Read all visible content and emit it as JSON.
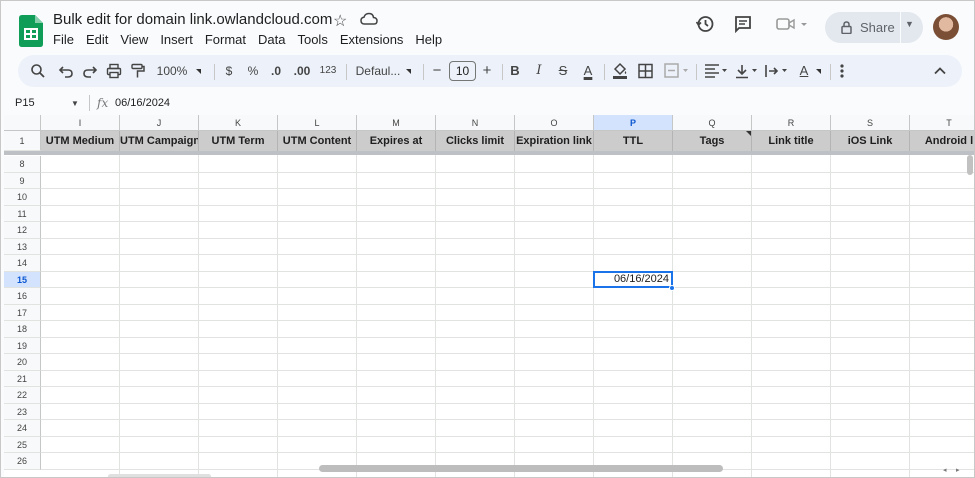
{
  "doc": {
    "title": "Bulk edit for domain link.owlandcloud.com",
    "menu": [
      "File",
      "Edit",
      "View",
      "Insert",
      "Format",
      "Data",
      "Tools",
      "Extensions",
      "Help"
    ],
    "share_label": "Share"
  },
  "toolbar": {
    "zoom": "100%",
    "currency": "$",
    "percent": "%",
    "dec_decrease": ".0",
    "dec_increase": ".00",
    "number_format": "123",
    "font": "Defaul...",
    "minus": "−",
    "font_size": "10",
    "plus": "+",
    "bold": "B",
    "italic": "I",
    "strike": "S",
    "text_color": "A",
    "text_color_2": "A",
    "accent": "#edf2fa"
  },
  "formula_bar": {
    "name_box": "P15",
    "fx": "fx",
    "value": "06/16/2024"
  },
  "grid": {
    "columns": [
      {
        "letter": "I",
        "header": "UTM Medium"
      },
      {
        "letter": "J",
        "header": "UTM Campaign"
      },
      {
        "letter": "K",
        "header": "UTM Term"
      },
      {
        "letter": "L",
        "header": "UTM Content"
      },
      {
        "letter": "M",
        "header": "Expires at"
      },
      {
        "letter": "N",
        "header": "Clicks limit"
      },
      {
        "letter": "O",
        "header": "Expiration link"
      },
      {
        "letter": "P",
        "header": "TTL"
      },
      {
        "letter": "Q",
        "header": "Tags"
      },
      {
        "letter": "R",
        "header": "Link title"
      },
      {
        "letter": "S",
        "header": "iOS Link"
      },
      {
        "letter": "T",
        "header": "Android l"
      }
    ],
    "header_row": "1",
    "rows": [
      "8",
      "9",
      "10",
      "11",
      "12",
      "13",
      "14",
      "15",
      "16",
      "17",
      "18",
      "19",
      "20",
      "21",
      "22",
      "23",
      "24",
      "25",
      "26"
    ],
    "selected_row": "15",
    "selected_col": "P",
    "selected_value": "06/16/2024"
  }
}
